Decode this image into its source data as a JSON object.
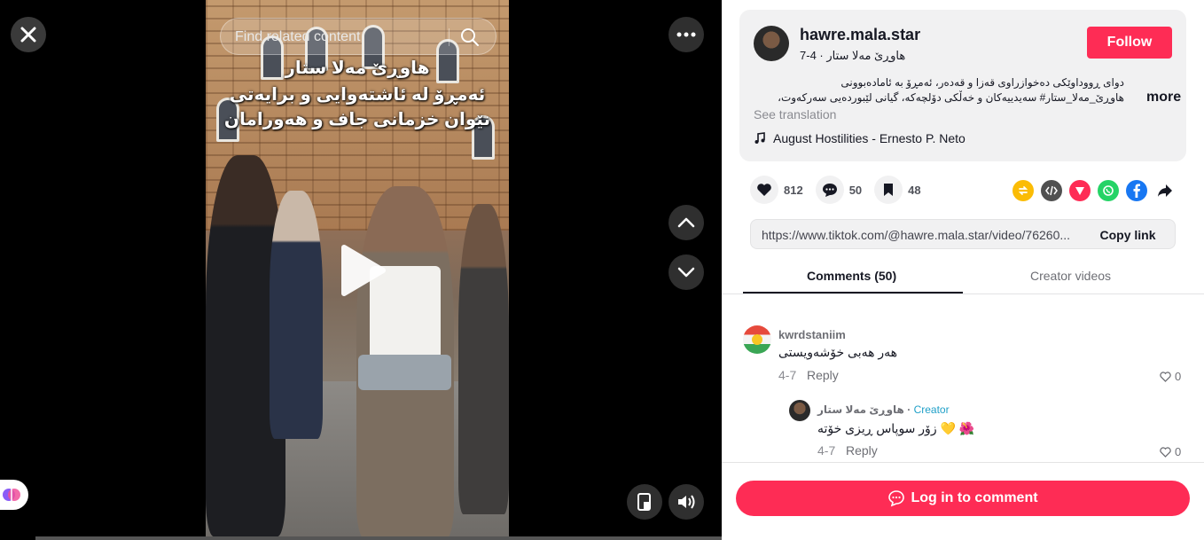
{
  "video": {
    "search_placeholder": "Find related content",
    "overlay_lines": [
      "هاوڕێ مەلا ستار",
      "ئەمڕۆ لە ئاشتەوایی و برایەتی",
      "نێوان خزمانی جاف و هەورامان"
    ]
  },
  "post": {
    "username": "hawre.mala.star",
    "display_name": "هاوڕێ مەلا ستار",
    "date": "4-7",
    "follow_label": "Follow",
    "description": "دوای ڕووداوێکی دەخوازراوی قەزا و قەدەر، ئەمڕۆ بە ئامادەبوونی هاوڕێ_مەلا_ستار# سەیدییەکان و خەڵکی دۆلچەکە، گیانی لێبوردەیی سەرکەوت، دەستخۆشی و پێزانینی زۆرمان",
    "more_label": "more",
    "see_translation": "See translation",
    "music": "August Hostilities - Ernesto P. Neto"
  },
  "stats": {
    "likes": "812",
    "comments": "50",
    "saves": "48"
  },
  "share": {
    "url": "https://www.tiktok.com/@hawre.mala.star/video/76260...",
    "copy_label": "Copy link"
  },
  "tabs": {
    "comments": "Comments (50)",
    "creator_videos": "Creator videos"
  },
  "comments": [
    {
      "username": "kwrdstaniim",
      "text": "هەر هەبی خۆشەویستی",
      "date": "4-7",
      "reply_label": "Reply",
      "likes": "0"
    },
    {
      "username": "هاوڕێ مەلا ستار",
      "creator_label": "Creator",
      "text": "زۆر سوپاس ڕیزی خۆتە",
      "date": "4-7",
      "reply_label": "Reply",
      "likes": "0"
    }
  ],
  "login_label": "Log in to comment",
  "colors": {
    "accent": "#fe2c55",
    "creator": "#20a0c8"
  }
}
